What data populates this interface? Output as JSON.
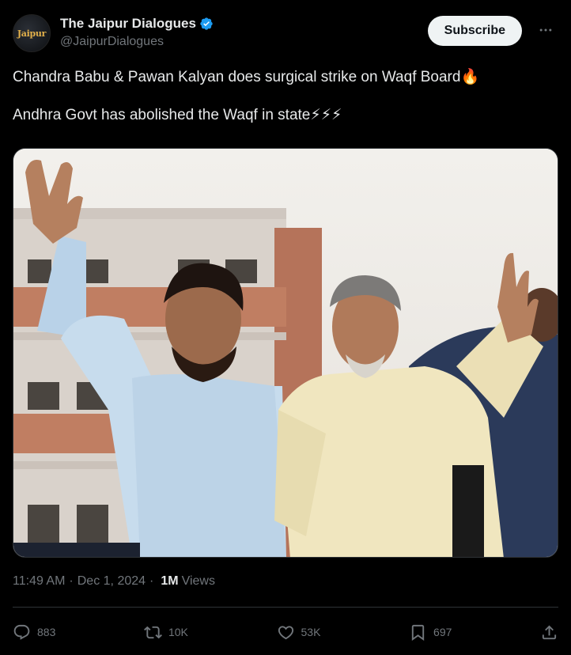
{
  "author": {
    "display_name": "The Jaipur Dialogues",
    "handle": "@JaipurDialogues",
    "avatar_text": "Jaipur",
    "verified": true
  },
  "subscribe_label": "Subscribe",
  "tweet": {
    "line1": "Chandra Babu & Pawan Kalyan does surgical strike on Waqf Board🔥",
    "line2": "Andhra Govt has abolished the Waqf in state⚡⚡⚡"
  },
  "meta": {
    "time": "11:49 AM",
    "date": "Dec 1, 2024",
    "views_count": "1M",
    "views_label": "Views"
  },
  "actions": {
    "replies": "883",
    "reposts": "10K",
    "likes": "53K",
    "bookmarks": "697"
  },
  "colors": {
    "accent_verified": "#1d9bf0",
    "muted": "#71767b",
    "text": "#e7e9ea",
    "border": "#2f3336"
  },
  "icons": [
    "verified-badge-icon",
    "more-icon",
    "reply-icon",
    "repost-icon",
    "like-icon",
    "bookmark-icon",
    "share-icon"
  ]
}
